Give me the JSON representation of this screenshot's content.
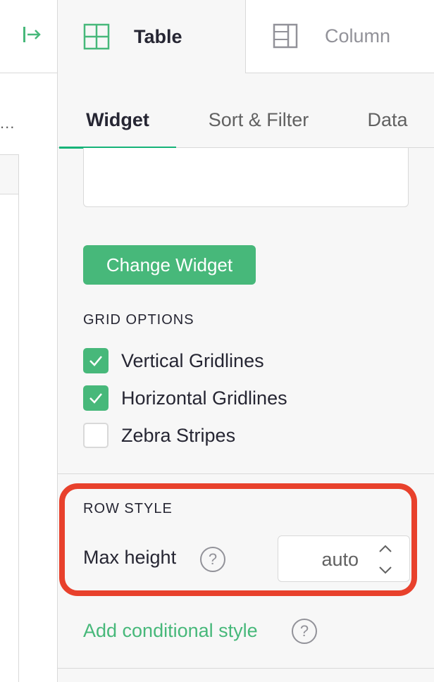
{
  "left_pane": {
    "dots": "..."
  },
  "top_tabs": [
    {
      "label": "Table",
      "icon": "table-icon",
      "active": true
    },
    {
      "label": "Column",
      "icon": "column-icon",
      "active": false
    }
  ],
  "sub_tabs": [
    {
      "label": "Widget",
      "active": true
    },
    {
      "label": "Sort & Filter",
      "active": false
    },
    {
      "label": "Data",
      "active": false
    }
  ],
  "widget": {
    "change_widget_label": "Change Widget"
  },
  "grid_options": {
    "heading": "GRID OPTIONS",
    "items": [
      {
        "label": "Vertical Gridlines",
        "checked": true
      },
      {
        "label": "Horizontal Gridlines",
        "checked": true
      },
      {
        "label": "Zebra Stripes",
        "checked": false
      }
    ]
  },
  "row_style": {
    "heading": "ROW STYLE",
    "max_height_label": "Max height",
    "help_glyph": "?",
    "max_height_value": "auto"
  },
  "conditional": {
    "add_label": "Add conditional style",
    "help_glyph": "?"
  },
  "colors": {
    "accent": "#47b87a",
    "tab_underline": "#16b378",
    "highlight_border": "#e8412c",
    "panel_bg": "#f7f7f7",
    "border": "#d9d9d9"
  }
}
